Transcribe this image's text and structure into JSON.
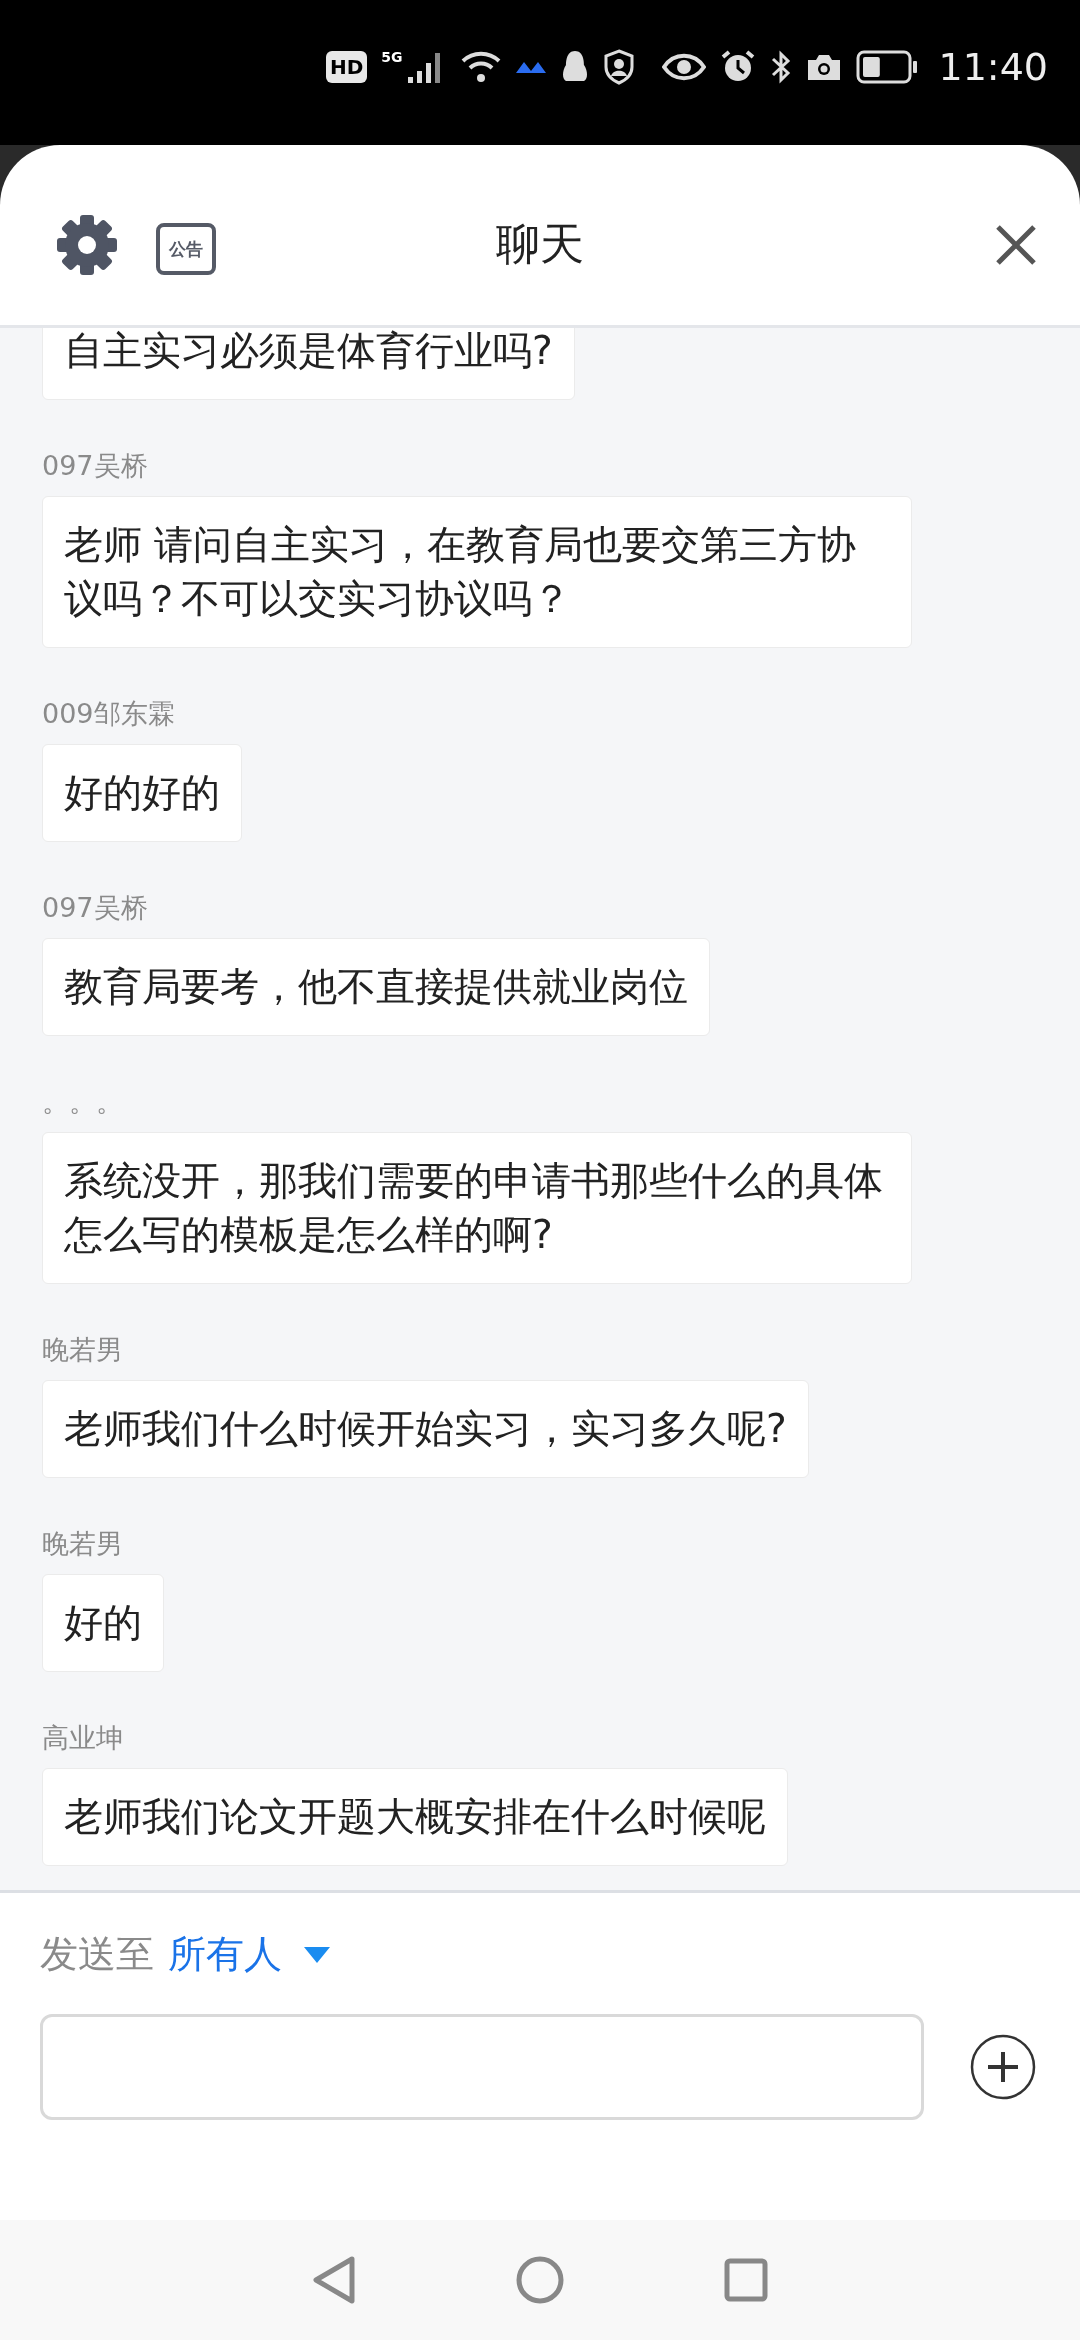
{
  "status_bar": {
    "hd": "HD",
    "network": "5G",
    "time": "11:40"
  },
  "header": {
    "notice_label": "公告",
    "title": "聊天"
  },
  "messages": [
    {
      "text": "自主实习必须是体育行业吗?"
    },
    {
      "sender": "097吴桥",
      "text": "老师 请问自主实习，在教育局也要交第三方协议吗？不可以交实习协议吗？"
    },
    {
      "sender": "009邹东霖",
      "text": "好的好的"
    },
    {
      "sender": "097吴桥",
      "text": "教育局要考，他不直接提供就业岗位"
    },
    {
      "sender": "。。。",
      "text": "系统没开，那我们需要的申请书那些什么的具体怎么写的模板是怎么样的啊?"
    },
    {
      "sender": "晚若男",
      "text": "老师我们什么时候开始实习，实习多久呢?"
    },
    {
      "sender": "晚若男",
      "text": "好的"
    },
    {
      "sender": "高业坤",
      "text": "老师我们论文开题大概安排在什么时候呢"
    }
  ],
  "composer": {
    "send_to_label": "发送至",
    "recipient": "所有人"
  }
}
